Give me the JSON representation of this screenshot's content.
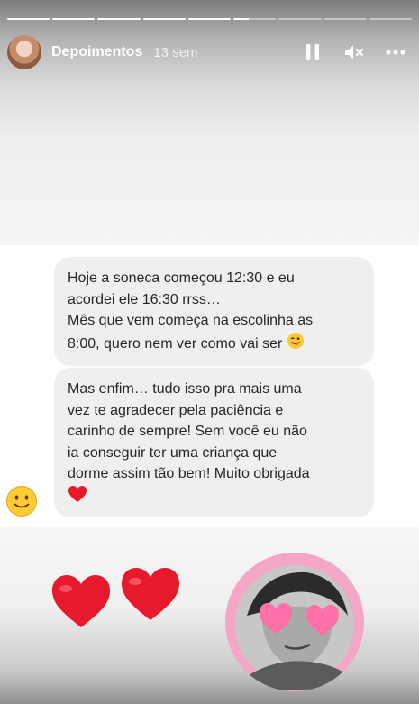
{
  "story": {
    "progress": [
      1,
      1,
      1,
      1,
      1,
      0.35,
      0,
      0,
      0
    ],
    "username": "Depoimentos",
    "timestamp": "13 sem",
    "controls": {
      "pause_icon": "pause-icon",
      "mute_icon": "muted-speaker-icon",
      "more_icon": "more-dots-icon"
    }
  },
  "messages": [
    {
      "lines": [
        "Hoje a soneca começou 12:30 e eu",
        "acordei ele 16:30 rrss…",
        "Mês que vem começa na escolinha as",
        "8:00, quero nem ver como vai ser"
      ],
      "emoji": "winking-tongue-face"
    },
    {
      "lines": [
        "Mas enfim… tudo isso pra mais uma",
        "vez te agradecer pela paciência e",
        "carinho de sempre! Sem você eu não",
        "ia conseguir ter uma criança que",
        "dorme assim tão bem! Muito obrigada"
      ],
      "emoji": "red-heart"
    }
  ],
  "reaction_emoji": "slightly-smiling-face",
  "stickers": {
    "hearts": [
      "red-heart",
      "red-heart"
    ],
    "selfie": "heart-eyes-selfie"
  },
  "colors": {
    "bubble": "#efefef",
    "text": "#262626",
    "heart": "#e8192c",
    "selfie_bg": "#f3a6c6"
  }
}
